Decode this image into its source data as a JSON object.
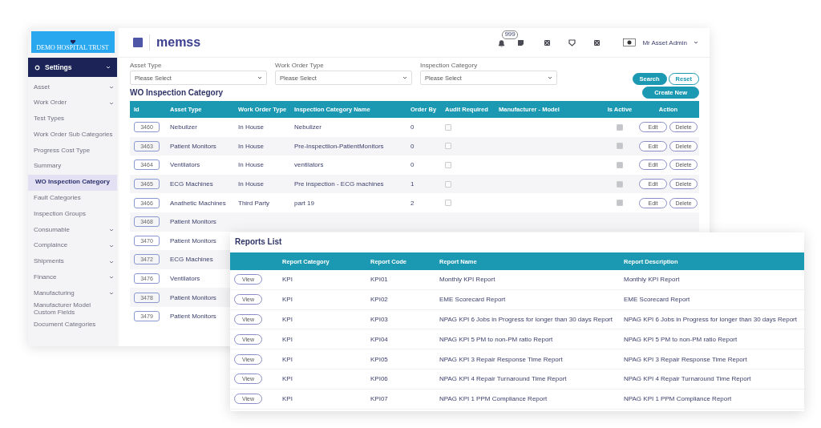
{
  "sidebar": {
    "brand": "DEMO HOSPITAL TRUST",
    "section": "Settings",
    "items": [
      {
        "label": "Asset",
        "expandable": true,
        "selected": false
      },
      {
        "label": "Work Order",
        "expandable": true,
        "selected": false
      },
      {
        "label": "Test Types",
        "expandable": false,
        "selected": false
      },
      {
        "label": "Work Order Sub Categories",
        "expandable": false,
        "selected": false
      },
      {
        "label": "Progress Cost Type",
        "expandable": false,
        "selected": false
      },
      {
        "label": "Summary",
        "expandable": false,
        "selected": false
      },
      {
        "label": "WO Inspection Category",
        "expandable": false,
        "selected": true
      },
      {
        "label": "Fault Categories",
        "expandable": false,
        "selected": false
      },
      {
        "label": "Inspection Groups",
        "expandable": false,
        "selected": false
      },
      {
        "label": "Consumable",
        "expandable": true,
        "selected": false
      },
      {
        "label": "Complaince",
        "expandable": true,
        "selected": false
      },
      {
        "label": "Shipments",
        "expandable": true,
        "selected": false
      },
      {
        "label": "Finance",
        "expandable": true,
        "selected": false
      },
      {
        "label": "Manufacturing",
        "expandable": true,
        "selected": false
      },
      {
        "label": "Manufacturer Model Custom Fields",
        "expandable": false,
        "selected": false
      },
      {
        "label": "Document Categories",
        "expandable": false,
        "selected": false
      }
    ]
  },
  "header": {
    "logo": "memss",
    "notification_count": "999",
    "user": "Mr Asset Admin"
  },
  "filters": [
    {
      "label": "Asset Type",
      "placeholder": "Please Select"
    },
    {
      "label": "Work Order Type",
      "placeholder": "Please Select"
    },
    {
      "label": "Inspection Category",
      "placeholder": "Please Select"
    }
  ],
  "buttons": {
    "search": "Search",
    "reset": "Reset",
    "create": "Create New"
  },
  "title": "WO Inspection Category",
  "table": {
    "columns": [
      "Id",
      "Asset Type",
      "Work Order Type",
      "Inspection Category Name",
      "Order By",
      "Audit Required",
      "Manufacturer - Model",
      "Is Active",
      "Action"
    ],
    "rows": [
      {
        "id": "3460",
        "asset_type": "Nebulizer",
        "wo_type": "In House",
        "name": "Nebulizer",
        "order": "0",
        "audit_required": false,
        "active": true,
        "edit": "Edit",
        "delete": "Delete"
      },
      {
        "id": "3463",
        "asset_type": "Patient Monitors",
        "wo_type": "In House",
        "name": "Pre-Inspectiion-PatientMonitors",
        "order": "0",
        "audit_required": false,
        "active": true,
        "edit": "Edit",
        "delete": "Delete"
      },
      {
        "id": "3464",
        "asset_type": "Ventilators",
        "wo_type": "In House",
        "name": "ventilators",
        "order": "0",
        "audit_required": false,
        "active": true,
        "edit": "Edit",
        "delete": "Delete"
      },
      {
        "id": "3465",
        "asset_type": "ECG Machines",
        "wo_type": "In House",
        "name": "Pre inspection - ECG machines",
        "order": "1",
        "audit_required": false,
        "active": true,
        "edit": "Edit",
        "delete": "Delete"
      },
      {
        "id": "3466",
        "asset_type": "Anathetic Machines",
        "wo_type": "Third Party",
        "name": "part 19",
        "order": "2",
        "audit_required": false,
        "active": true,
        "edit": "Edit",
        "delete": "Delete"
      },
      {
        "id": "3468",
        "asset_type": "Patient Monitors"
      },
      {
        "id": "3470",
        "asset_type": "Patient Monitors"
      },
      {
        "id": "3472",
        "asset_type": "ECG Machines"
      },
      {
        "id": "3476",
        "asset_type": "Ventilators"
      },
      {
        "id": "3478",
        "asset_type": "Patient Monitors"
      },
      {
        "id": "3479",
        "asset_type": "Patient Monitors"
      }
    ]
  },
  "reports": {
    "title": "Reports List",
    "columns": [
      "Report Category",
      "Report Code",
      "Report Name",
      "Report Description"
    ],
    "rows": [
      {
        "view": "View",
        "category": "KPI",
        "code": "KPI01",
        "name": "Monthly KPI Report",
        "description": "Monthly KPI Report"
      },
      {
        "view": "View",
        "category": "KPI",
        "code": "KPI02",
        "name": "EME Scorecard Report",
        "description": "EME Scorecard Report"
      },
      {
        "view": "View",
        "category": "KPI",
        "code": "KPI03",
        "name": "NPAG KPI 6 Jobs in Progress for longer than 30 days Report",
        "description": "NPAG KPI 6 Jobs in Progress for longer than 30 days Report"
      },
      {
        "view": "View",
        "category": "KPI",
        "code": "KPI04",
        "name": "NPAG KPI 5 PM to non-PM ratio Report",
        "description": "NPAG KPI 5 PM to non-PM ratio Report"
      },
      {
        "view": "View",
        "category": "KPI",
        "code": "KPI05",
        "name": "NPAG KPI 3 Repair Response Time Report",
        "description": "NPAG KPI 3 Repair Response Time Report"
      },
      {
        "view": "View",
        "category": "KPI",
        "code": "KPI06",
        "name": "NPAG KPI 4 Repair Turnaround Time Report",
        "description": "NPAG KPI 4 Repair Turnaround Time Report"
      },
      {
        "view": "View",
        "category": "KPI",
        "code": "KPI07",
        "name": "NPAG KPI 1 PPM Compliance Report",
        "description": "NPAG KPI 1 PPM Compliance Report"
      }
    ]
  }
}
